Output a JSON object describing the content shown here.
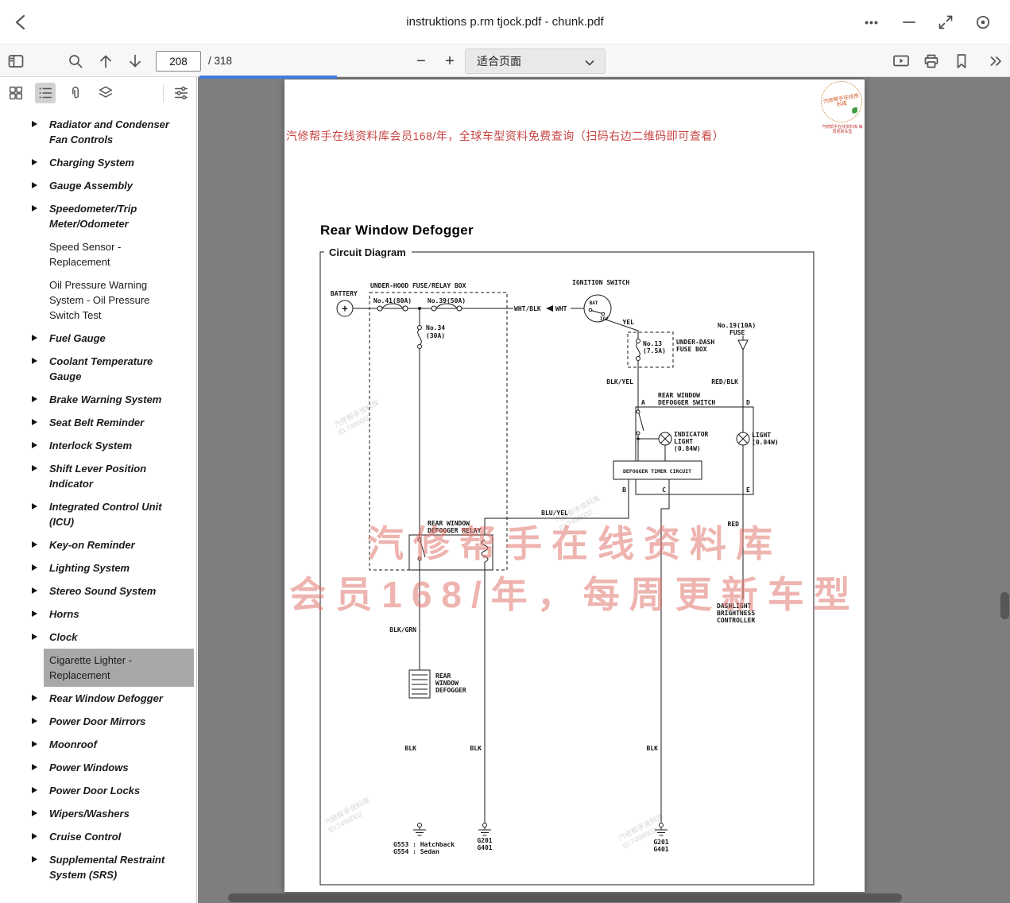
{
  "colors": {
    "accent": "#3f7ce0",
    "banner_red": "#c84444",
    "watermark_pink": "rgba(224,118,112,0.55)",
    "selected_gray": "#a8a8a8",
    "canvas_gray": "#7e7e7e",
    "ink": "#1a1a1a"
  },
  "icons": {
    "more": "•••",
    "zoom_out": "−",
    "zoom_in": "+"
  },
  "titlebar": {
    "title": "instruktions p.rm tjock.pdf - chunk.pdf"
  },
  "toolbar": {
    "page_current": "208",
    "page_total": "/ 318",
    "zoom_fit_label": "适合页面"
  },
  "sidebar": {
    "items": [
      {
        "label": "Radiator and Condenser Fan Controls",
        "kind": "section"
      },
      {
        "label": "Charging System",
        "kind": "section"
      },
      {
        "label": "Gauge Assembly",
        "kind": "section"
      },
      {
        "label": "Speedometer/Trip Meter/Odometer",
        "kind": "section"
      },
      {
        "label": "Speed Sensor - Replacement",
        "kind": "plain"
      },
      {
        "label": "Oil Pressure Warning System - Oil Pressure Switch Test",
        "kind": "plain"
      },
      {
        "label": "Fuel Gauge",
        "kind": "section"
      },
      {
        "label": "Coolant Temperature Gauge",
        "kind": "section"
      },
      {
        "label": "Brake Warning System",
        "kind": "section"
      },
      {
        "label": "Seat Belt Reminder",
        "kind": "section"
      },
      {
        "label": "Interlock System",
        "kind": "section"
      },
      {
        "label": "Shift Lever Position Indicator",
        "kind": "section"
      },
      {
        "label": "Integrated Control Unit (ICU)",
        "kind": "section"
      },
      {
        "label": "Key-on Reminder",
        "kind": "section"
      },
      {
        "label": "Lighting System",
        "kind": "section"
      },
      {
        "label": "Stereo Sound System",
        "kind": "section"
      },
      {
        "label": "Horns",
        "kind": "section"
      },
      {
        "label": "Clock",
        "kind": "section"
      },
      {
        "label": "Cigarette Lighter - Replacement",
        "kind": "plain",
        "selected": true
      },
      {
        "label": "Rear Window Defogger",
        "kind": "section"
      },
      {
        "label": "Power Door Mirrors",
        "kind": "section"
      },
      {
        "label": "Moonroof",
        "kind": "section"
      },
      {
        "label": "Power Windows",
        "kind": "section"
      },
      {
        "label": "Power Door Locks",
        "kind": "section"
      },
      {
        "label": "Wipers/Washers",
        "kind": "section"
      },
      {
        "label": "Cruise Control",
        "kind": "section"
      },
      {
        "label": "Supplemental Restraint System (SRS)",
        "kind": "section"
      }
    ]
  },
  "page": {
    "banner": "汽修帮手在线资料库会员168/年，全球车型资料免费查询（扫码右边二维码即可查看）",
    "stamp_text": "汽修帮手在线资料库",
    "stamp_caption": "汽修帮手在线资料库 每周更新车型",
    "title": "Rear Window Defogger",
    "watermark": {
      "line1": "汽修帮手在线资料库",
      "line2": "会员168/年，每周更新车型",
      "small_name": "汽修帮手资料库",
      "small_id": "ID:7496002"
    },
    "diagram": {
      "frame_label": "Circuit Diagram",
      "battery": "BATTERY",
      "battery_plus": "+",
      "underhood_box": "UNDER-HOOD FUSE/RELAY BOX",
      "fuse41": "No.41(80A)",
      "fuse39": "No.39(50A)",
      "fuse34_1": "No.34",
      "fuse34_2": "(30A)",
      "ignition": "IGNITION SWITCH",
      "bat": "BAT",
      "ig2": "IG2",
      "wht_blk": "WHT/BLK",
      "wht": "WHT",
      "yel": "YEL",
      "fuse13_1": "No.13",
      "fuse13_2": "(7.5A)",
      "underdash_1": "UNDER-DASH",
      "underdash_2": "FUSE BOX",
      "fuse19_1": "No.19(10A)",
      "fuse19_2": "FUSE",
      "blk_yel": "BLK/YEL",
      "red_blk": "RED/BLK",
      "switch_1": "REAR WINDOW",
      "switch_2": "DEFOGGER SWITCH",
      "term_a": "A",
      "term_b": "B",
      "term_c": "C",
      "term_d": "D",
      "term_e": "E",
      "ind_1": "INDICATOR",
      "ind_2": "LIGHT",
      "ind_3": "(0.84W)",
      "light_1": "LIGHT",
      "light_2": "(0.84W)",
      "timer": "DEFOGGER TIMER CIRCUIT",
      "blu_yel": "BLU/YEL",
      "red": "RED",
      "relay_1": "REAR WINDOW",
      "relay_2": "DEFOGGER RELAY",
      "dash_1": "DASHLIGHT",
      "dash_2": "BRIGHTNESS",
      "dash_3": "CONTROLLER",
      "blk_grn": "BLK/GRN",
      "defog_1": "REAR",
      "defog_2": "WINDOW",
      "defog_3": "DEFOGGER",
      "blk": "BLK",
      "gnd_left_1": "G553 : Hatchback",
      "gnd_left_2": "G554 : Sedan",
      "g201": "G201",
      "g401": "G401"
    }
  }
}
